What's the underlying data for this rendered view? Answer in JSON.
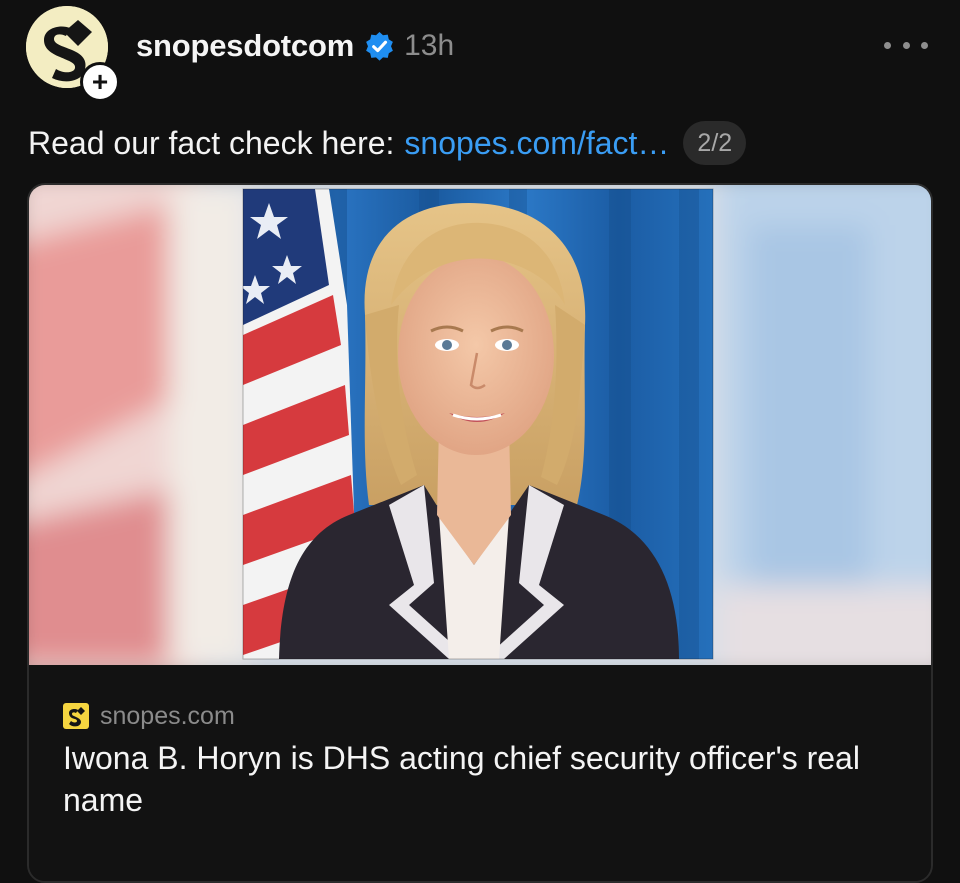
{
  "post": {
    "username": "snopesdotcom",
    "timestamp": "13h",
    "follow_symbol": "+",
    "verified_icon": "verified-badge-icon",
    "more_icon": "more-options-icon",
    "text_prefix": "Read our fact check here:",
    "link_text": "snopes.com/fact…",
    "counter": "2/2"
  },
  "card": {
    "source_domain": "snopes.com",
    "title": "Iwona B. Horyn is DHS acting chief security officer's real name"
  },
  "colors": {
    "background": "#101010",
    "link": "#3a9df4",
    "verified": "#1f8ef1",
    "avatar_bg": "#f3edc2",
    "muted_text": "#8d8d8d"
  }
}
